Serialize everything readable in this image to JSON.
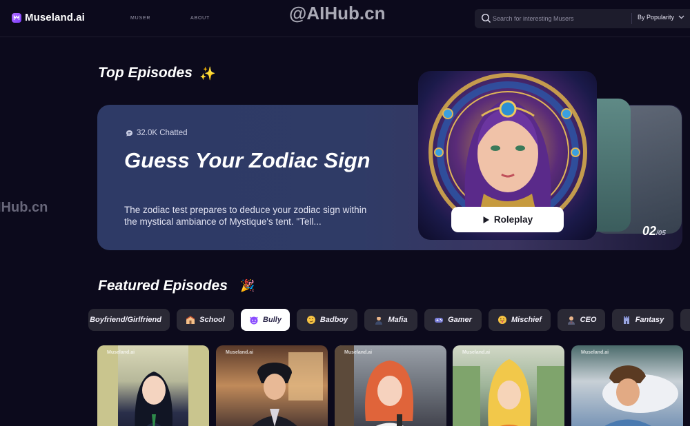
{
  "header": {
    "logo_text": "Museland.ai",
    "nav": [
      "MUSER",
      "ABOUT"
    ],
    "watermark": "@AIHub.cn",
    "search_placeholder": "Search for interesting Musers",
    "sort_label": "By Popularity"
  },
  "side_watermark": "IHub.cn",
  "top_episodes": {
    "title": "Top Episodes",
    "emoji": "✨",
    "featured": {
      "chatted": "32.0K Chatted",
      "title": "Guess Your Zodiac Sign",
      "description": "The zodiac test prepares to deduce your zodiac sign within the mystical ambiance of Mystique's tent. \"Tell...",
      "button_label": "Roleplay"
    },
    "pager_current": "02",
    "pager_total": "/05"
  },
  "featured_episodes": {
    "title": "Featured Episodes",
    "emoji": "🎉",
    "categories": [
      {
        "label": "Boyfriend/Girlfriend",
        "icon": "none"
      },
      {
        "label": "School",
        "icon": "school-icon"
      },
      {
        "label": "Bully",
        "icon": "devil-icon"
      },
      {
        "label": "Badboy",
        "icon": "smirk-icon"
      },
      {
        "label": "Mafia",
        "icon": "mafia-icon"
      },
      {
        "label": "Gamer",
        "icon": "gamepad-icon"
      },
      {
        "label": "Mischief",
        "icon": "tongue-face-icon"
      },
      {
        "label": "CEO",
        "icon": "ceo-icon"
      },
      {
        "label": "Fantasy",
        "icon": "castle-icon"
      }
    ],
    "selected_category": "Bully",
    "card_watermark": "Museland.ai"
  },
  "colors": {
    "background": "#0c0a1c",
    "hero_blue": "#2f3b66",
    "chip_bg": "#2a2935",
    "accent_purple": "#8b4dff"
  }
}
